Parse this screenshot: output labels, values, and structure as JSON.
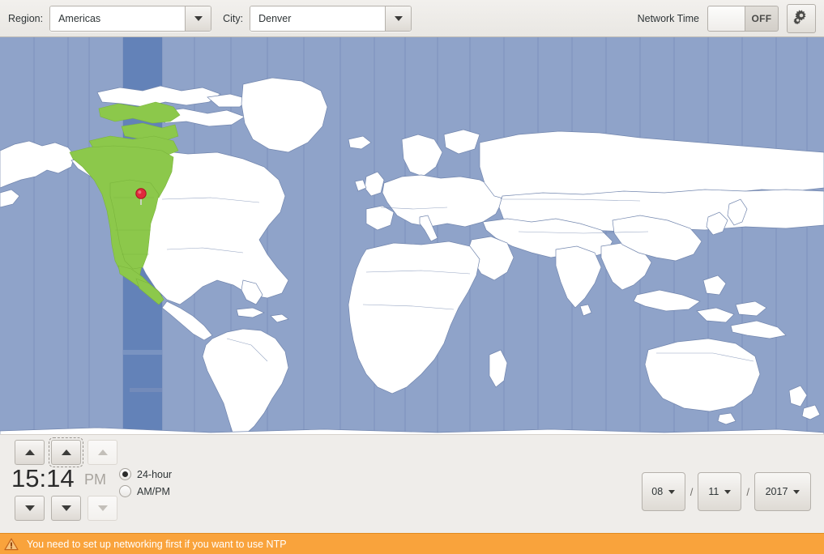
{
  "toolbar": {
    "region_label": "Region:",
    "region_value": "Americas",
    "city_label": "City:",
    "city_value": "Denver",
    "network_time_label": "Network Time",
    "network_time_state": "OFF",
    "settings_icon": "gears-icon",
    "region_dropdown_icon": "chevron-down-icon",
    "city_dropdown_icon": "chevron-down-icon"
  },
  "map": {
    "ocean_color": "#8fa3c9",
    "land_color": "#ffffff",
    "highlight_color": "#8cc84b",
    "highlight_band_color": "#5c7cb5",
    "border_color": "#6f83ad",
    "marker_color": "#e02b3c",
    "marker_name": "location-pin-marker",
    "marker_city": "Denver"
  },
  "time": {
    "hours": "15",
    "minutes": "14",
    "separator": ":",
    "display": "15:14",
    "ampm": "PM",
    "ampm_enabled": false,
    "hour_up_icon": "chevron-up-icon",
    "hour_down_icon": "chevron-down-icon",
    "minute_up_icon": "chevron-up-icon",
    "minute_down_icon": "chevron-down-icon",
    "ampm_up_icon": "chevron-up-icon",
    "ampm_down_icon": "chevron-down-icon",
    "format_options": [
      {
        "label": "24-hour",
        "selected": true
      },
      {
        "label": "AM/PM",
        "selected": false
      }
    ]
  },
  "date": {
    "day": "08",
    "month": "11",
    "year": "2017",
    "separator": "/",
    "day_dropdown_icon": "chevron-down-icon",
    "month_dropdown_icon": "chevron-down-icon",
    "year_dropdown_icon": "chevron-down-icon"
  },
  "warning": {
    "icon": "warning-triangle-icon",
    "message": "You need to set up networking first if you want to use NTP",
    "background_color": "#f9a33c",
    "text_color": "#ffffff"
  }
}
